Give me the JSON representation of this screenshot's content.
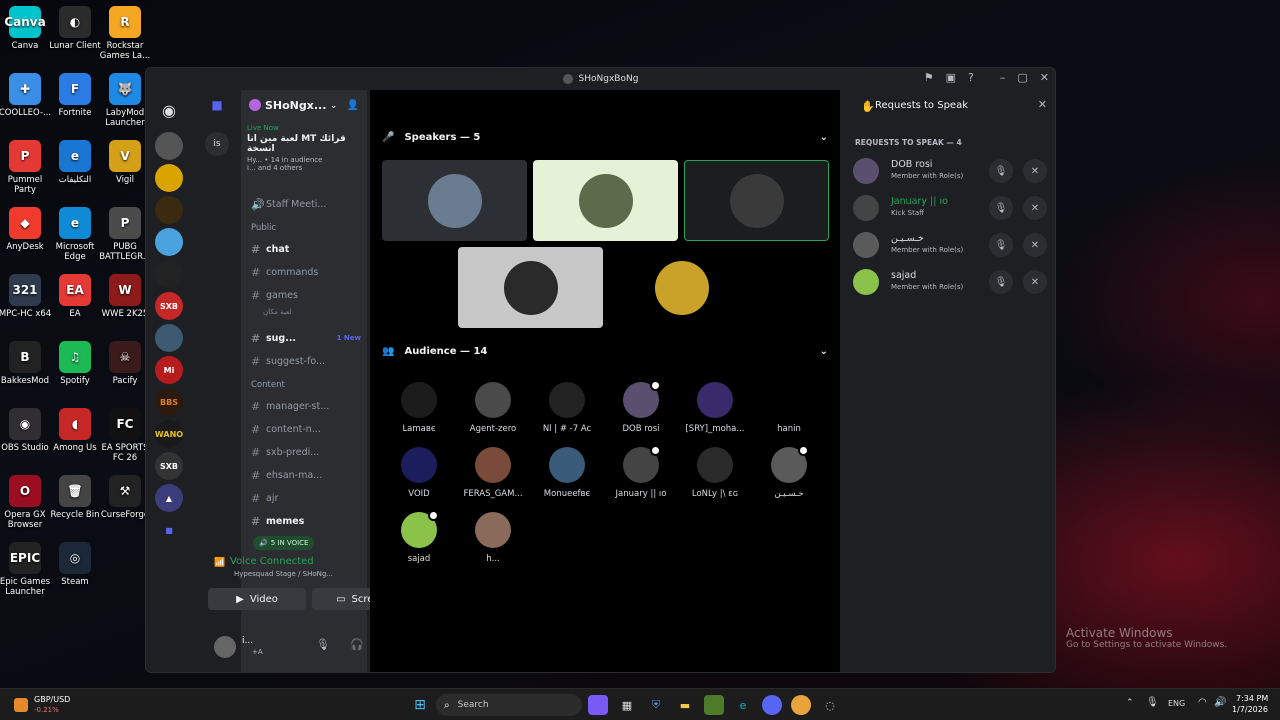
{
  "desktop": {
    "icons": [
      {
        "label": "Canva",
        "glyph": "Canva",
        "color": "#00c4cc"
      },
      {
        "label": "Lunar Client",
        "glyph": "◐",
        "color": "#2b2b2b"
      },
      {
        "label": "Rockstar Games La...",
        "glyph": "R",
        "color": "#f5a623"
      },
      {
        "label": "COOLLEO-...",
        "glyph": "✚",
        "color": "#3a8ee6"
      },
      {
        "label": "Fortnite",
        "glyph": "F",
        "color": "#2a7be4"
      },
      {
        "label": "LabyMod Launcher",
        "glyph": "🐺",
        "color": "#1e88e5"
      },
      {
        "label": "Pummel Party",
        "glyph": "P",
        "color": "#e53935"
      },
      {
        "label": "التكليفات",
        "glyph": "e",
        "color": "#1976d2"
      },
      {
        "label": "Vigil",
        "glyph": "V",
        "color": "#d4a017"
      },
      {
        "label": "AnyDesk",
        "glyph": "◆",
        "color": "#ef3b2d"
      },
      {
        "label": "Microsoft Edge",
        "glyph": "e",
        "color": "#0f8bd6"
      },
      {
        "label": "PUBG BATTLEGR...",
        "glyph": "P",
        "color": "#4b4b4b"
      },
      {
        "label": "MPC-HC x64",
        "glyph": "321",
        "color": "#2e3b4e"
      },
      {
        "label": "EA",
        "glyph": "EA",
        "color": "#e53935"
      },
      {
        "label": "WWE 2K25",
        "glyph": "W",
        "color": "#8e1b1b"
      },
      {
        "label": "BakkesMod",
        "glyph": "B",
        "color": "#222"
      },
      {
        "label": "Spotify",
        "glyph": "♫",
        "color": "#1db954"
      },
      {
        "label": "Pacify",
        "glyph": "☠",
        "color": "#3a1a1a"
      },
      {
        "label": "OBS Studio",
        "glyph": "◉",
        "color": "#302e31"
      },
      {
        "label": "Among Us",
        "glyph": "◖",
        "color": "#c62828"
      },
      {
        "label": "EA SPORTS FC 26",
        "glyph": "FC",
        "color": "#111"
      },
      {
        "label": "Opera GX Browser",
        "glyph": "O",
        "color": "#9b0e22"
      },
      {
        "label": "Recycle Bin",
        "glyph": "🗑",
        "color": "#444"
      },
      {
        "label": "CurseForge",
        "glyph": "⚒",
        "color": "#222"
      },
      {
        "label": "Epic Games Launcher",
        "glyph": "EPIC",
        "color": "#222"
      },
      {
        "label": "Steam",
        "glyph": "◎",
        "color": "#1b2838"
      }
    ]
  },
  "window": {
    "title": "SHoNgxBoNg",
    "controls": {
      "minimize": "–",
      "maximize": "▢",
      "close": "✕"
    }
  },
  "guilds": {
    "folder_badge": "is"
  },
  "channels": {
    "server_name": "SHoNgx...",
    "live": {
      "tag": "Live Now",
      "title": "قرائك MT لعبة مين انا انسخة",
      "meta": "Hy... • 14 in audience",
      "others": "i... and 4 others"
    },
    "items": [
      {
        "name": "Staff Meeti...",
        "type": "voice"
      },
      {
        "name": "Public",
        "type": "category"
      },
      {
        "name": "chat",
        "type": "text",
        "active": true
      },
      {
        "name": "commands",
        "type": "text"
      },
      {
        "name": "games",
        "type": "text"
      },
      {
        "name": "لعبة مكان",
        "type": "sub"
      },
      {
        "name": "sug...",
        "type": "text",
        "active": true,
        "badge": "1 New"
      },
      {
        "name": "suggest-fo...",
        "type": "text"
      },
      {
        "name": "Content",
        "type": "category"
      },
      {
        "name": "manager-st...",
        "type": "text"
      },
      {
        "name": "content-n...",
        "type": "text"
      },
      {
        "name": "sxb-predi...",
        "type": "text"
      },
      {
        "name": "ehsan-ma...",
        "type": "text"
      },
      {
        "name": "ajr",
        "type": "text"
      },
      {
        "name": "memes",
        "type": "text",
        "active": true
      }
    ],
    "in_voice": "5 IN VOICE",
    "voice_connected": "Voice Connected",
    "voice_location": "Hypesquad Stage / SHoNg...",
    "video_label": "Video",
    "screen_label": "Screen",
    "user_name": "i...",
    "user_status": "+A"
  },
  "stage": {
    "speakers_header": "Speakers — 5",
    "audience_header": "Audience — 14",
    "speakers": [
      {
        "color": "#2c2f33",
        "avatar": "#6a7c8f"
      },
      {
        "color": "#e6f2d8",
        "avatar": "#5d6b4a"
      },
      {
        "color": "#1b1d1f",
        "avatar": "#3a3a3a"
      },
      {
        "color": "#c8c8c8",
        "avatar": "#2a2a2a"
      },
      {
        "color": "#000000",
        "avatar": "#c9a227"
      }
    ],
    "audience": [
      {
        "name": "Lamaвє",
        "avatar": "#1c1c1c"
      },
      {
        "name": "Agent-zero",
        "avatar": "#4a4a4a"
      },
      {
        "name": "Nl | # -7 Ac",
        "avatar": "#222"
      },
      {
        "name": "DOB rosi",
        "avatar": "#5a4f6e"
      },
      {
        "name": "[SRY]_moha...",
        "avatar": "#3b2a6b"
      },
      {
        "name": "hanin",
        "avatar": "#000000"
      },
      {
        "name": "VOID",
        "avatar": "#1c1d5c"
      },
      {
        "name": "FERAS_GAM...",
        "avatar": "#7a4a3a"
      },
      {
        "name": "Monueefвє",
        "avatar": "#3a5a7a"
      },
      {
        "name": "January || ıo",
        "avatar": "#444"
      },
      {
        "name": "LoNLy |\\ ɛɢ",
        "avatar": "#2a2a2a"
      },
      {
        "name": "خـسـيـن",
        "avatar": "#5a5a5a"
      },
      {
        "name": "sajad",
        "avatar": "#8bc34a"
      },
      {
        "name": "h...",
        "avatar": "#8a6a5a"
      }
    ]
  },
  "requests": {
    "title": "Requests to Speak",
    "count_label": "REQUESTS TO SPEAK — 4",
    "items": [
      {
        "name": "DOB rosi",
        "role": "Member with Role(s)",
        "color": "#dbdee1",
        "avatar": "#5a4f6e"
      },
      {
        "name": "January || ıo",
        "role": "Kick Staff",
        "color": "#23a55a",
        "avatar": "#444"
      },
      {
        "name": "خـسـيـن",
        "role": "Member with Role(s)",
        "color": "#dbdee1",
        "avatar": "#5a5a5a"
      },
      {
        "name": "sajad",
        "role": "Member with Role(s)",
        "color": "#dbdee1",
        "avatar": "#8bc34a"
      }
    ]
  },
  "taskbar": {
    "ticker": "GBP/USD",
    "ticker_change": "-0.21%",
    "search_label": "Search",
    "lang": "ENG",
    "time": "7:34 PM",
    "date": "1/7/2026"
  },
  "watermark": {
    "title": "Activate Windows",
    "subtitle": "Go to Settings to activate Windows."
  }
}
